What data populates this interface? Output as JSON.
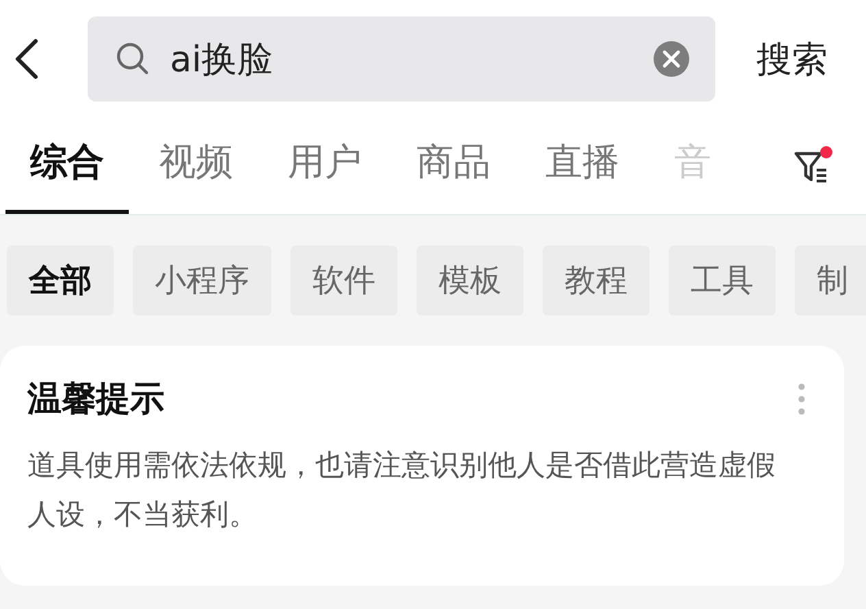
{
  "search": {
    "value": "ai换脸",
    "button": "搜索"
  },
  "tabs": [
    {
      "label": "综合",
      "selected": true
    },
    {
      "label": "视频",
      "selected": false
    },
    {
      "label": "用户",
      "selected": false
    },
    {
      "label": "商品",
      "selected": false
    },
    {
      "label": "直播",
      "selected": false
    },
    {
      "label": "音",
      "selected": false
    }
  ],
  "filter": {
    "has_badge": true
  },
  "chips": [
    {
      "label": "全部",
      "selected": true
    },
    {
      "label": "小程序",
      "selected": false
    },
    {
      "label": "软件",
      "selected": false
    },
    {
      "label": "模板",
      "selected": false
    },
    {
      "label": "教程",
      "selected": false
    },
    {
      "label": "工具",
      "selected": false
    },
    {
      "label": "制",
      "selected": false
    }
  ],
  "notice": {
    "title": "温馨提示",
    "text": "道具使用需依法依规，也请注意识别他人是否借此营造虚假人设，不当获利。"
  }
}
